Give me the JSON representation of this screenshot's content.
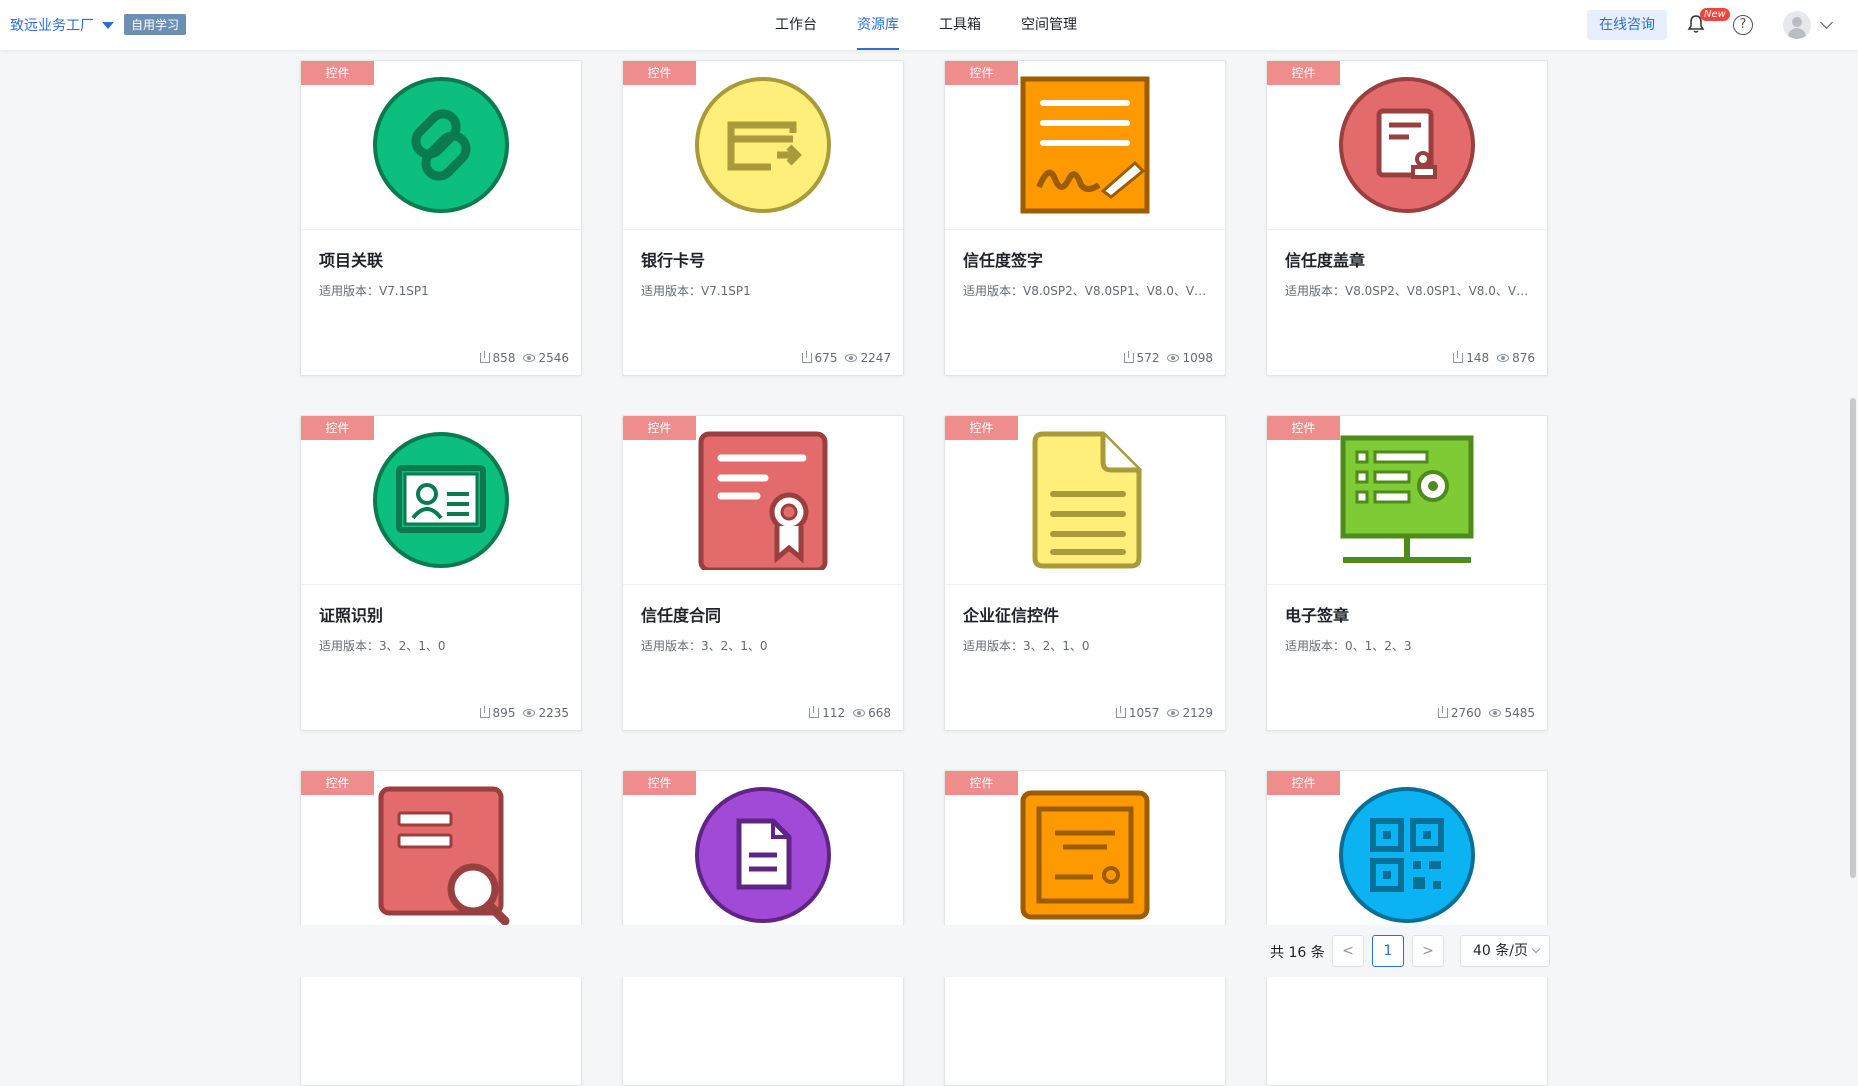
{
  "header": {
    "brand_name": "致远业务工厂",
    "brand_tag": "自用学习",
    "nav": [
      "工作台",
      "资源库",
      "工具箱",
      "空间管理"
    ],
    "active_nav": "资源库",
    "consult_label": "在线咨询",
    "new_badge": "New",
    "help_label": "?"
  },
  "cards": [
    {
      "tag": "控件",
      "title": "项目关联",
      "version_label": "适用版本：",
      "version": "V7.1SP1",
      "downloads": "858",
      "views": "2546",
      "icon": "link-icon",
      "color": "#0dbf7f"
    },
    {
      "tag": "控件",
      "title": "银行卡号",
      "version_label": "适用版本：",
      "version": "V7.1SP1",
      "downloads": "675",
      "views": "2247",
      "icon": "bank-card-icon",
      "color": "#fdef7a"
    },
    {
      "tag": "控件",
      "title": "信任度签字",
      "version_label": "适用版本：",
      "version": "V8.0SP2、V8.0SP1、V8.0、V7...",
      "downloads": "572",
      "views": "1098",
      "icon": "signature-icon",
      "color": "#ff9900"
    },
    {
      "tag": "控件",
      "title": "信任度盖章",
      "version_label": "适用版本：",
      "version": "V8.0SP2、V8.0SP1、V8.0、V7...",
      "downloads": "148",
      "views": "876",
      "icon": "stamp-icon",
      "color": "#e46b6b"
    },
    {
      "tag": "控件",
      "title": "证照识别",
      "version_label": "适用版本：",
      "version": "3、2、1、0",
      "downloads": "895",
      "views": "2235",
      "icon": "id-card-icon",
      "color": "#0dbf7f"
    },
    {
      "tag": "控件",
      "title": "信任度合同",
      "version_label": "适用版本：",
      "version": "3、2、1、0",
      "downloads": "112",
      "views": "668",
      "icon": "certificate-icon",
      "color": "#e46b6b"
    },
    {
      "tag": "控件",
      "title": "企业征信控件",
      "version_label": "适用版本：",
      "version": "3、2、1、0",
      "downloads": "1057",
      "views": "2129",
      "icon": "document-icon",
      "color": "#fdef7a"
    },
    {
      "tag": "控件",
      "title": "电子签章",
      "version_label": "适用版本：",
      "version": "0、1、2、3",
      "downloads": "2760",
      "views": "5485",
      "icon": "monitor-form-icon",
      "color": "#7ecb35"
    },
    {
      "tag": "控件",
      "title": "",
      "version_label": "",
      "version": "",
      "downloads": "",
      "views": "",
      "icon": "search-doc-icon",
      "color": "#e46b6b"
    },
    {
      "tag": "控件",
      "title": "",
      "version_label": "",
      "version": "",
      "downloads": "",
      "views": "",
      "icon": "file-icon",
      "color": "#a24ad8"
    },
    {
      "tag": "控件",
      "title": "",
      "version_label": "",
      "version": "",
      "downloads": "",
      "views": "",
      "icon": "certificate-frame-icon",
      "color": "#ff9900"
    },
    {
      "tag": "控件",
      "title": "",
      "version_label": "",
      "version": "",
      "downloads": "",
      "views": "",
      "icon": "qr-code-icon",
      "color": "#0bb3f2"
    }
  ],
  "pagination": {
    "total": "共 16 条",
    "prev": "<",
    "current": "1",
    "next": ">",
    "page_size": "40 条/页"
  }
}
